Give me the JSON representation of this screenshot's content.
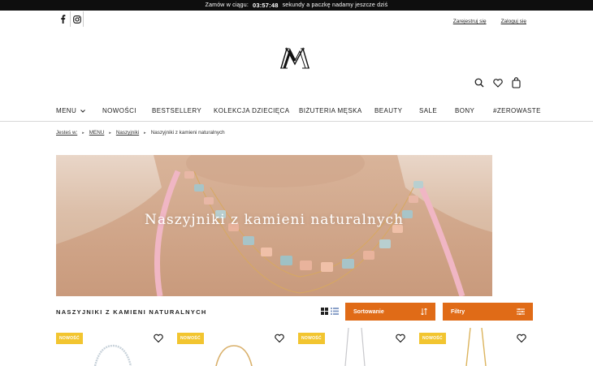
{
  "topbar": {
    "prefix": "Zamów w ciągu:",
    "timer": "03:57:48",
    "suffix": "sekundy a paczkę nadamy jeszcze dziś"
  },
  "account": {
    "register": "Zarejestruj się",
    "login": "Zaloguj się"
  },
  "nav": [
    "MENU",
    "NOWOŚCI",
    "BESTSELLERY",
    "KOLEKCJA DZIECIĘCA",
    "BIŻUTERIA MĘSKA",
    "BEAUTY",
    "SALE",
    "BONY",
    "#ZEROWASTE"
  ],
  "breadcrumb": {
    "prefix": "Jesteś w:",
    "items": [
      "MENU",
      "Naszyjniki"
    ],
    "current": "Naszyjniki z kamieni naturalnych"
  },
  "hero": {
    "title": "Naszyjniki z kamieni naturalnych"
  },
  "listing": {
    "heading": "NASZYJNIKI Z KAMIENI NATURALNYCH",
    "sort_label": "Sortowanie",
    "filter_label": "Filtry"
  },
  "products": [
    {
      "badge": "NOWOŚĆ"
    },
    {
      "badge": "NOWOŚĆ"
    },
    {
      "badge": "NOWOŚĆ"
    },
    {
      "badge": "NOWOŚĆ"
    }
  ],
  "colors": {
    "accent": "#e06b17",
    "badge": "#f2c530",
    "topbar": "#0e0e0e"
  },
  "icons": [
    "facebook-icon",
    "instagram-icon",
    "search-icon",
    "heart-icon",
    "bag-icon",
    "chevron-down-icon",
    "grid-view-icon",
    "list-view-icon",
    "sort-icon",
    "filter-icon"
  ]
}
